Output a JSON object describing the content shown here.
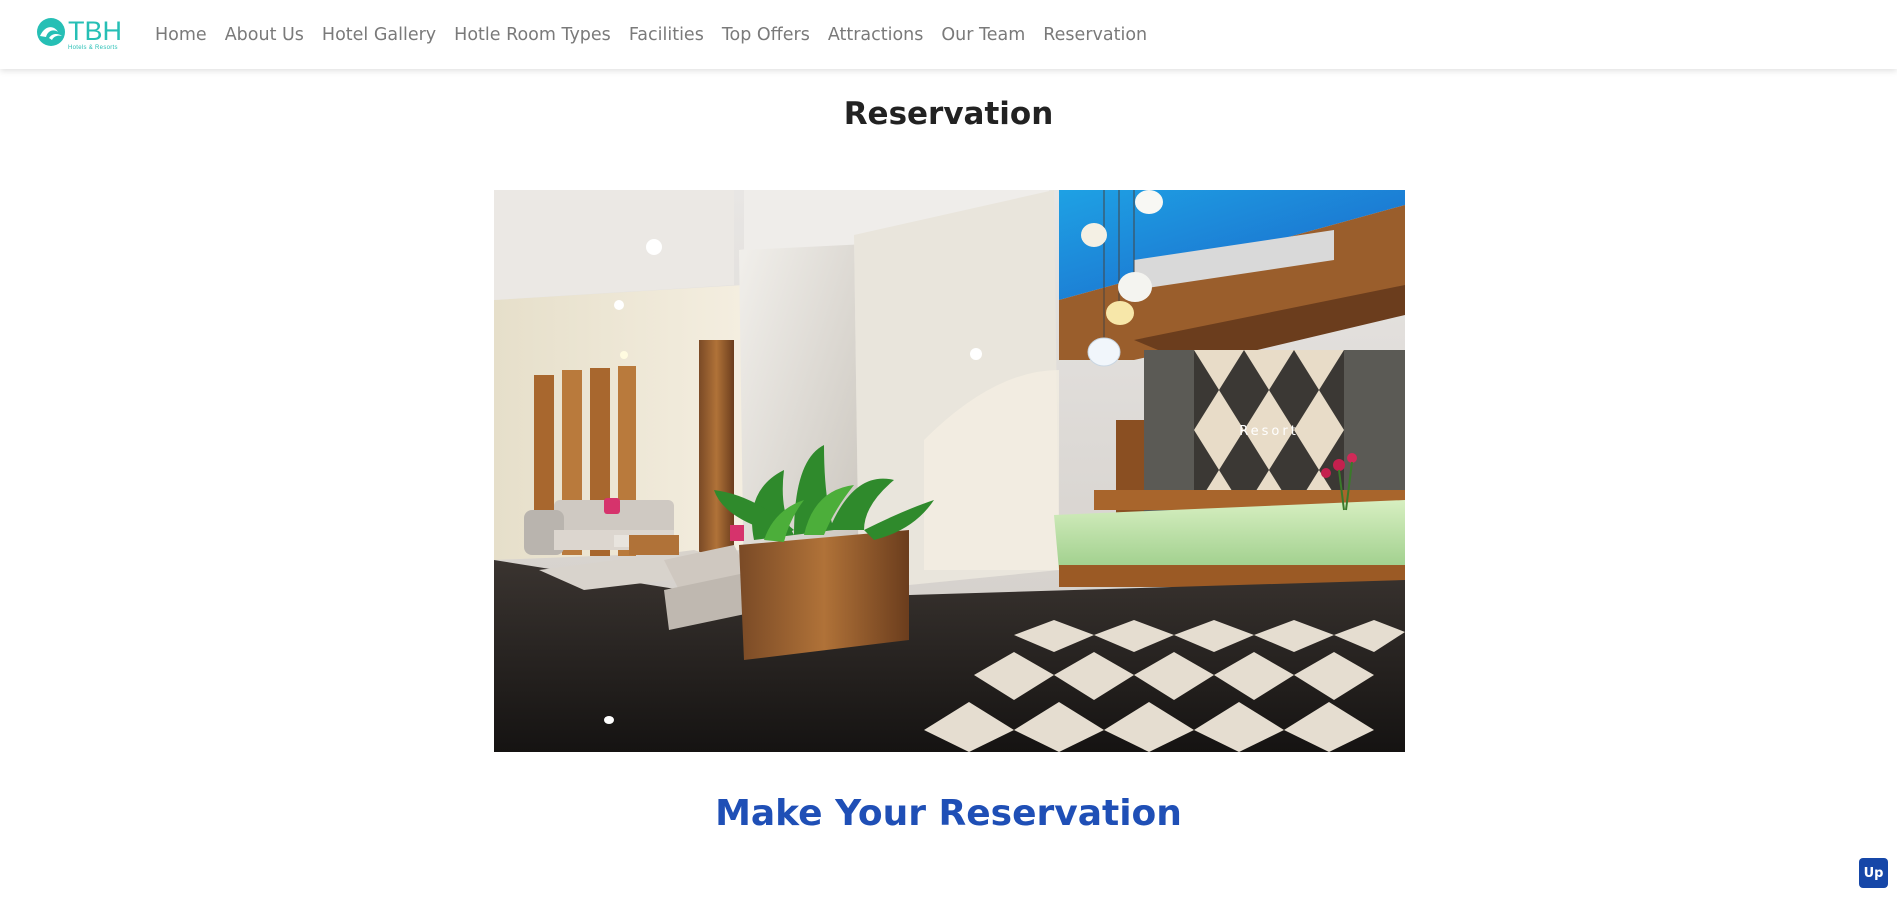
{
  "brand": {
    "name": "TBH",
    "tagline": "Hotels & Resorts",
    "color": "#26bfb5",
    "icon": "wave-icon"
  },
  "nav": {
    "items": [
      {
        "label": "Home"
      },
      {
        "label": "About Us"
      },
      {
        "label": "Hotel Gallery"
      },
      {
        "label": "Hotle Room Types"
      },
      {
        "label": "Facilities"
      },
      {
        "label": "Top Offers"
      },
      {
        "label": "Attractions"
      },
      {
        "label": "Our Team"
      },
      {
        "label": "Reservation"
      }
    ]
  },
  "page": {
    "title": "Reservation",
    "hero_image": {
      "sign_text": "Resort"
    },
    "section_title": "Make Your Reservation",
    "section_color": "#1f4fb6"
  },
  "scroll_top": {
    "label": "Up",
    "color": "#1647a8"
  }
}
